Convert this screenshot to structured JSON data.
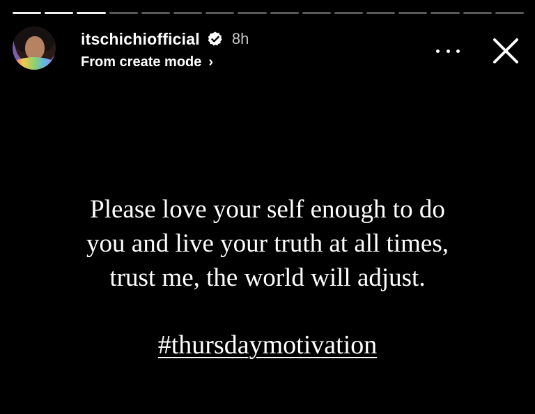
{
  "story": {
    "progress": {
      "segments_total": 16,
      "segments_viewed": 3
    },
    "user": {
      "username": "itschichiofficial",
      "verified": true,
      "time_ago": "8h",
      "subtitle": "From create mode",
      "subtitle_chevron": "›"
    },
    "message": {
      "lines": [
        "Please love your self enough to do",
        "you and live your truth at all times,",
        "trust me, the world will adjust."
      ],
      "hashtag": "#thursdaymotivation"
    },
    "colors": {
      "background": "#000000",
      "text": "#ffffff",
      "muted_text": "#c8c8c8"
    },
    "icons": {
      "verified": "verified-badge-icon",
      "more": "more-dots-icon",
      "close": "close-icon"
    }
  }
}
